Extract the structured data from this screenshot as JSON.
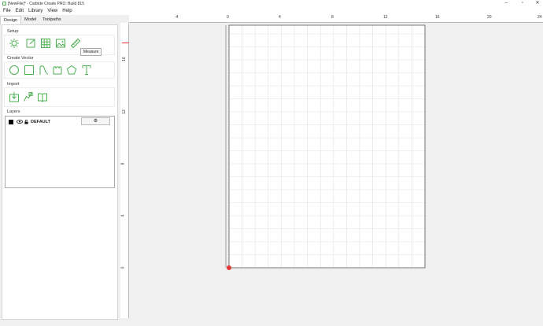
{
  "window": {
    "title": "[NewFile]* - Carbide Create PRO: Build 815",
    "minimize": "–",
    "maximize": "▫",
    "close": "✕"
  },
  "menu": [
    "File",
    "Edit",
    "Library",
    "View",
    "Help"
  ],
  "tabs": [
    "Design",
    "Model",
    "Toolpaths"
  ],
  "sections": {
    "setup": "Setup",
    "create_vector": "Create Vector",
    "import": "Import",
    "layers": "Layers"
  },
  "tooltip": "Measure",
  "layer": {
    "name": "DEFAULT",
    "color": "#000000"
  },
  "ruler_top_labels": [
    "-4",
    "0",
    "4",
    "8",
    "12",
    "16",
    "20",
    "24"
  ],
  "ruler_left_labels": [
    "16",
    "12",
    "8",
    "4",
    "0"
  ],
  "colors": {
    "accent": "#4caf50",
    "origin": "#e53935"
  }
}
